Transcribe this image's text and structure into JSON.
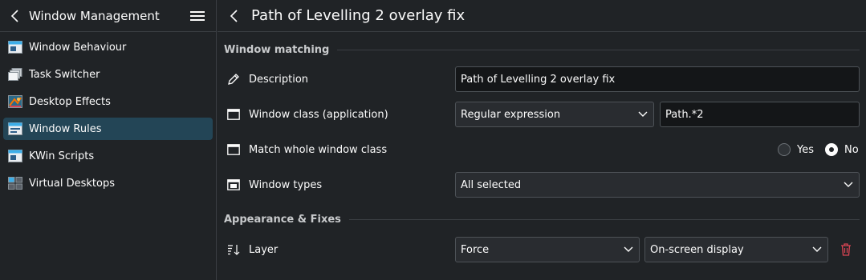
{
  "sidebar": {
    "title": "Window Management",
    "items": [
      {
        "label": "Window Behaviour",
        "icon": "window-behaviour-icon"
      },
      {
        "label": "Task Switcher",
        "icon": "task-switcher-icon"
      },
      {
        "label": "Desktop Effects",
        "icon": "desktop-effects-icon"
      },
      {
        "label": "Window Rules",
        "icon": "window-rules-icon",
        "active": true
      },
      {
        "label": "KWin Scripts",
        "icon": "kwin-scripts-icon"
      },
      {
        "label": "Virtual Desktops",
        "icon": "virtual-desktops-icon"
      }
    ]
  },
  "page": {
    "title": "Path of Levelling 2 overlay fix"
  },
  "window_matching": {
    "heading": "Window matching",
    "description": {
      "label": "Description",
      "value": "Path of Levelling 2 overlay fix"
    },
    "window_class": {
      "label": "Window class (application)",
      "match_type": "Regular expression",
      "value": "Path.*2"
    },
    "whole_class": {
      "label": "Match whole window class",
      "yes": "Yes",
      "no": "No",
      "selected": "No"
    },
    "window_types": {
      "label": "Window types",
      "value": "All selected"
    }
  },
  "appearance": {
    "heading": "Appearance & Fixes",
    "layer": {
      "label": "Layer",
      "policy": "Force",
      "value": "On-screen display"
    }
  },
  "colors": {
    "background": "#202326",
    "active_item": "#234556",
    "delete": "#da4453"
  }
}
